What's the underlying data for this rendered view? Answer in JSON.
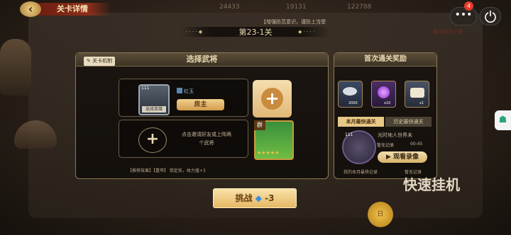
{
  "header": {
    "title": "关卡详情",
    "back_icon": "back-arrow-icon"
  },
  "top_resources": [
    "24433",
    "19131",
    "122788"
  ],
  "top_right": {
    "notification_count": "4",
    "menu_icon": "more-dots-icon",
    "power_icon": "power-icon"
  },
  "notice": "【增强防范意识，谨防上当受",
  "stage": {
    "label": "第23-1关"
  },
  "stamp_text": "最佳通关记录",
  "left_panel": {
    "chip_label": "关卡机制",
    "title": "选择武将",
    "hero": {
      "level": "111",
      "tag": "选择英雄",
      "name": "红玉",
      "role_button": "房主"
    },
    "invite_text": "点击邀请好友或上阵两个武将",
    "pet_badge": "群",
    "stars": "★★★★★",
    "hint": "【推荐效果】【重甲】 锁定技，体力值+3"
  },
  "right_panel": {
    "title": "首次通关奖励",
    "rewards": [
      {
        "icon": "silver-ingot-icon",
        "count": "2000"
      },
      {
        "icon": "purple-orb-icon",
        "count": "x10"
      },
      {
        "icon": "scroll-icon",
        "count": "x1"
      }
    ],
    "tabs": [
      "本月最快通关",
      "历史最快通关"
    ],
    "player_level": "111",
    "player_name": "光时地人世界未",
    "record_label": "暂无记录",
    "time": "00:45",
    "replay_button": "观看录像",
    "footer_left": "我的本月最快记录",
    "footer_right": "暂无记录"
  },
  "bottom": {
    "challenge_label": "挑战",
    "challenge_cost": "-3",
    "logo_text": "快速挂机",
    "coin_label": "日"
  },
  "colors": {
    "accent": "#e5b866",
    "panel_border": "#8b7a55",
    "title_plate": "#8e2e1a"
  }
}
